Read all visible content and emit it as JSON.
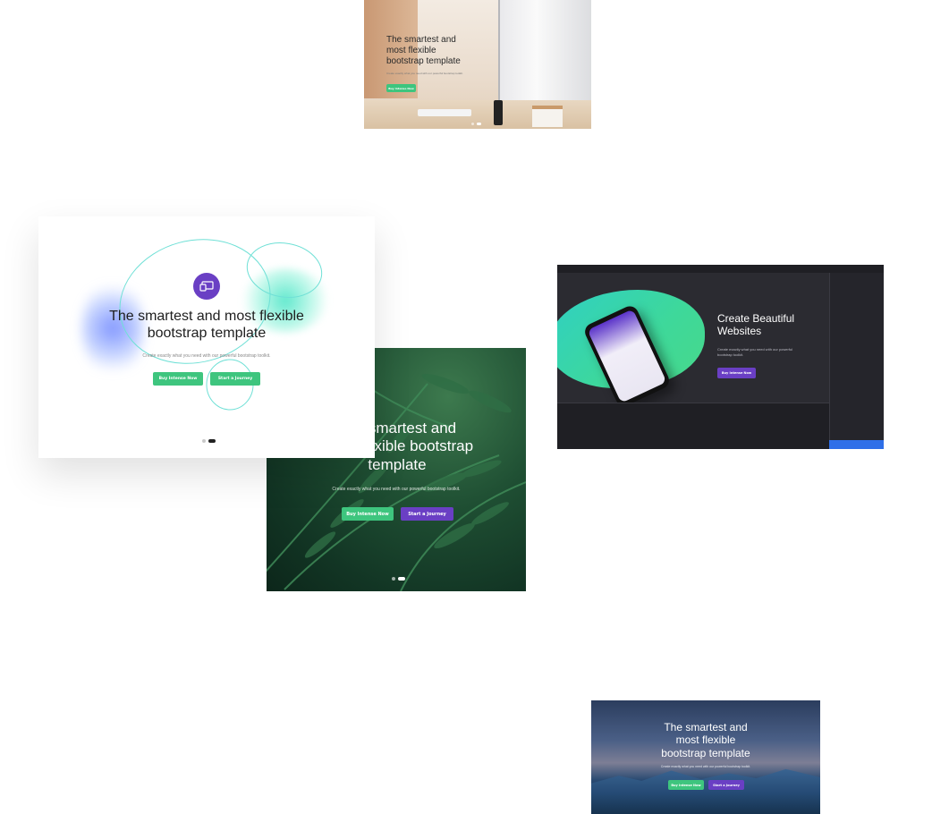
{
  "cards": {
    "desk": {
      "headline": "The smartest and most flexible bootstrap template",
      "subtitle": "Create exactly what you need with our powerful bootstrap toolkit.",
      "button_label": "Buy Intense Now"
    },
    "light": {
      "headline": "The smartest and most flexible bootstrap template",
      "subtitle": "Create exactly what you need with our powerful bootstrap toolkit.",
      "primary_button": "Buy Intense Now",
      "secondary_button": "Start a Journey"
    },
    "fern": {
      "headline": "The smartest and most flexible bootstrap template",
      "subtitle": "Create exactly what you need with our powerful bootstrap toolkit.",
      "primary_button": "Buy Intense Now",
      "secondary_button": "Start a Journey"
    },
    "builder": {
      "headline": "Create Beautiful Websites",
      "subtitle": "Create exactly what you need with our powerful bootstrap toolkit.",
      "button_label": "Buy Intense Now"
    },
    "mountain": {
      "headline": "The smartest and most flexible bootstrap template",
      "subtitle": "Create exactly what you need with our powerful bootstrap toolkit.",
      "primary_button": "Buy Intense Now",
      "secondary_button": "Start a Journey"
    }
  },
  "colors": {
    "green": "#3ec57e",
    "purple": "#6a3fc4",
    "cyan": "#5fe0d4"
  }
}
